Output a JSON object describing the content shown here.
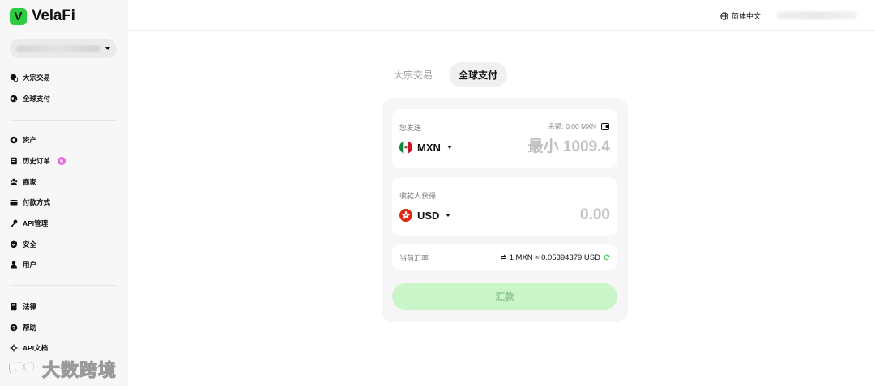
{
  "brand": {
    "mark": "V",
    "name": "VelaFi",
    "accent": "#2ecc40"
  },
  "sidebar": {
    "groups": [
      [
        {
          "label": "大宗交易",
          "icon": "bulk-trade-icon"
        },
        {
          "label": "全球支付",
          "icon": "globe-icon"
        }
      ],
      [
        {
          "label": "资产",
          "icon": "asset-icon"
        },
        {
          "label": "历史订单",
          "icon": "history-icon",
          "badge": "6"
        },
        {
          "label": "商家",
          "icon": "merchant-icon"
        },
        {
          "label": "付款方式",
          "icon": "card-icon"
        },
        {
          "label": "API管理",
          "icon": "api-key-icon"
        },
        {
          "label": "安全",
          "icon": "shield-icon"
        },
        {
          "label": "用户",
          "icon": "user-icon"
        }
      ],
      [
        {
          "label": "法律",
          "icon": "book-icon"
        },
        {
          "label": "帮助",
          "icon": "help-icon"
        },
        {
          "label": "API文档",
          "icon": "api-doc-icon"
        }
      ]
    ]
  },
  "watermark": {
    "text": "大数跨境"
  },
  "header": {
    "language": "简体中文"
  },
  "tabs": [
    {
      "label": "大宗交易",
      "active": false
    },
    {
      "label": "全球支付",
      "active": true
    }
  ],
  "transfer": {
    "send": {
      "label": "您发送",
      "balance": "余额: 0.00 MXN",
      "currency": "MXN",
      "placeholder": "最小 1009.4"
    },
    "receive": {
      "label": "收款人获得",
      "currency": "USD",
      "amount": "0.00"
    },
    "rate": {
      "label": "当前汇率",
      "value": "1 MXN ≈ 0.05394379 USD"
    },
    "submit_label": "汇款",
    "submit_color": "#c9f5c9"
  }
}
